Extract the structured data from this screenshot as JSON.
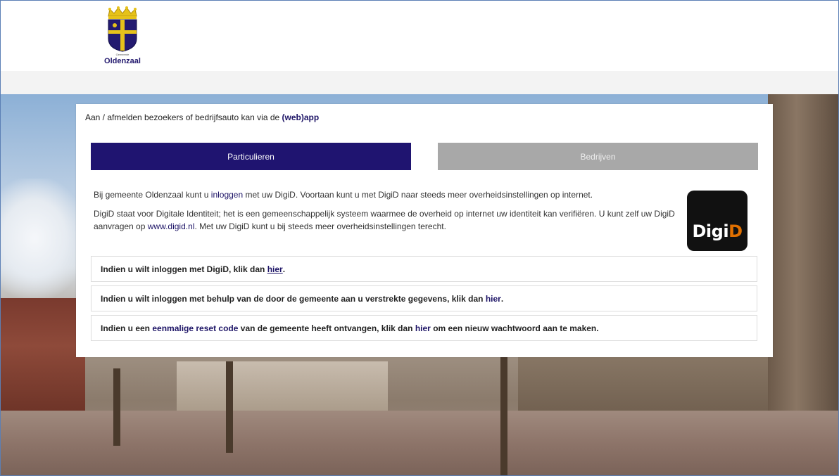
{
  "header": {
    "logo_town": "Oldenzaal",
    "logo_subtitle": "Gemeente"
  },
  "notice": {
    "text": "Aan / afmelden bezoekers of bedrijfsauto kan via de ",
    "link": "(web)app"
  },
  "tabs": [
    {
      "label": "Particulieren",
      "active": true
    },
    {
      "label": "Bedrijven",
      "active": false
    }
  ],
  "intro": {
    "p1_a": "Bij gemeente Oldenzaal kunt u ",
    "p1_link": "inloggen",
    "p1_b": " met uw DigiD. Voortaan kunt u met DigiD naar steeds meer overheidsinstellingen op internet.",
    "p2_a": "DigiD staat voor Digitale Identiteit; het is een gemeenschappelijk systeem waarmee de overheid op internet uw identiteit kan verifiëren. U kunt zelf uw DigiD aanvragen op ",
    "p2_link": "www.digid.nl",
    "p2_b": ". Met uw DigiD kunt u bij steeds meer overheidsinstellingen terecht."
  },
  "digid_logo": {
    "part1": "Digi",
    "part2": "D",
    "colors": {
      "bg": "#111111",
      "accent": "#e17000"
    }
  },
  "options": [
    {
      "text_a": "Indien u wilt inloggen met DigiD, klik dan ",
      "link": "hier",
      "text_b": "."
    },
    {
      "text_a": "Indien u wilt inloggen met behulp van de door de gemeente aan u verstrekte gegevens, klik dan ",
      "link": "hier",
      "text_b": "."
    },
    {
      "text_a": "Indien u een ",
      "link_mid": "eenmalige reset code",
      "text_mid": " van de gemeente heeft ontvangen, klik dan ",
      "link": "hier",
      "text_b": " om een nieuw wachtwoord aan te maken."
    }
  ],
  "colors": {
    "brand": "#1f1470",
    "tab_inactive": "#a8a8a8",
    "link": "#1d1466"
  }
}
